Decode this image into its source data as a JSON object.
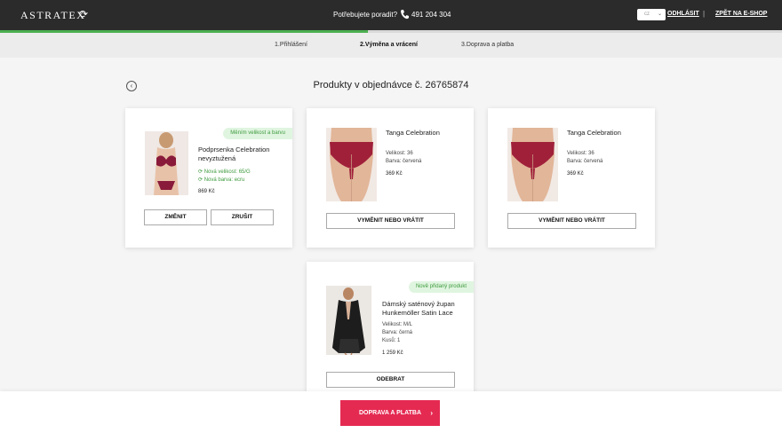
{
  "header": {
    "logo": "ASTRATEX",
    "help_text": "Potřebujete poradit?",
    "phone": "491 204 304",
    "lang_value": "cz",
    "logout": "ODHLÁSIT",
    "separator": "|",
    "back_to_shop": "ZPĚT NA E-SHOP"
  },
  "progress": {
    "fraction": 0.47,
    "color": "#4caf50"
  },
  "steps": [
    "1.Přihlášení",
    "2.Výměna a vrácení",
    "3.Doprava a platba"
  ],
  "page": {
    "title": "Produkty v objednávce č. 26765874",
    "back_icon": "chevron-left-icon"
  },
  "products": [
    {
      "badge": "Měním velikost a barvu",
      "name_line1": "Podprsenka Celebration",
      "name_line2": "nevyztužená",
      "line1": "Nová velikost: 65/G",
      "line2": "Nová barva: ecru",
      "price": "869 Kč",
      "btn1": "ZMĚNIT",
      "btn2": "ZRUŠIT"
    },
    {
      "name_line1": "Tanga Celebration",
      "line1": "Velikost: 36",
      "line2": "Barva: červená",
      "price": "369 Kč",
      "btn1": "VYMĚNIT NEBO VRÁTIT"
    },
    {
      "name_line1": "Tanga Celebration",
      "line1": "Velikost: 36",
      "line2": "Barva: červená",
      "price": "369 Kč",
      "btn1": "VYMĚNIT NEBO VRÁTIT"
    },
    {
      "badge": "Nově přidaný produkt",
      "name_line1": "Dámský saténový župan",
      "name_line2": "Hunkemöller Satin Lace",
      "line1": "Velikost: M/L",
      "line2": "Barva: černá",
      "line3": "Kusů: 1",
      "price": "1 259 Kč",
      "btn1": "ODEBRAT"
    }
  ],
  "footer": {
    "cta": "DOPRAVA A PLATBA",
    "cta_color": "#e52a52"
  }
}
